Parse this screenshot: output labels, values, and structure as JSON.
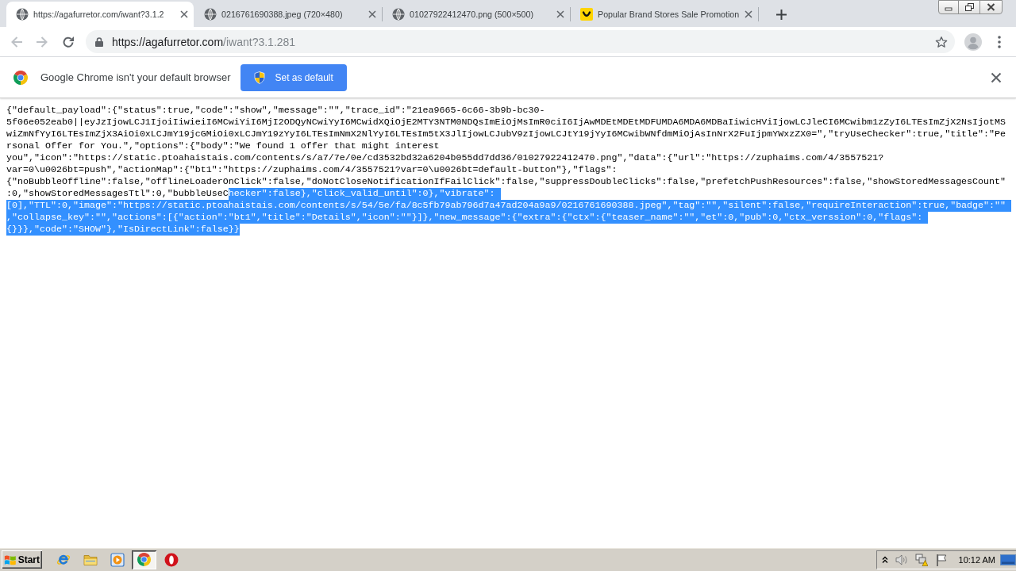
{
  "tabs": [
    {
      "title": "https://agafurretor.com/iwant?3.1.2",
      "kind": "globe",
      "selected": true
    },
    {
      "title": "0216761690388.jpeg (720×480)",
      "kind": "globe",
      "selected": false
    },
    {
      "title": "01027922412470.png (500×500)",
      "kind": "globe",
      "selected": false
    },
    {
      "title": "Popular Brand Stores Sale Promotion",
      "kind": "smiley",
      "selected": false
    }
  ],
  "toolbar": {
    "nav_buttons": [
      {
        "kind": "back",
        "disabled": true
      },
      {
        "kind": "forward",
        "disabled": true
      },
      {
        "kind": "reload",
        "disabled": false
      }
    ],
    "address": {
      "host": "https://agafurretor.com",
      "path": "/iwant?3.1.281"
    }
  },
  "infobar": {
    "message": "Google Chrome isn't your default browser",
    "button": "Set as default"
  },
  "page_text": {
    "lines": [
      {
        "segments": [
          {
            "text": "{\"default_payload\":{\"status\":true,\"code\":\"show\",\"message\":\"\",\"trace_id\":\"21ea9665-6c66-3b9b-bc30-",
            "selected": false
          }
        ]
      },
      {
        "segments": [
          {
            "text": "5f06e052eab0||eyJzIjowLCJ1IjoiIiwieiI6MCwiYiI6MjI2ODQyNCwiYyI6MCwidXQiOjE2MTY3NTM0NDQsImEiOjMsImR0ciI6IjAwMDEtMDEtMDFUMDA6MDA6MDBaIiwicHViIjowLCJleCI6MCwibm1zZyI6LTEsImZjX2NsIjotMS",
            "selected": false
          }
        ]
      },
      {
        "segments": [
          {
            "text": "wiZmNfYyI6LTEsImZjX3AiOi0xLCJmY19jcGMiOi0xLCJmY19zYyI6LTEsImNmX2NlYyI6LTEsIm5tX3JlIjowLCJubV9zIjowLCJtY19jYyI6MCwibWNfdmMiOjAsInNrX2FuIjpmYWxzZX0=\",\"tryUseChecker\":true,\"title\":\"Pe",
            "selected": false
          }
        ]
      },
      {
        "segments": [
          {
            "text": "rsonal Offer for You.\",\"options\":{\"body\":\"We found 1 offer that might interest",
            "selected": false
          }
        ]
      },
      {
        "segments": [
          {
            "text": "you\",\"icon\":\"https://static.ptoahaistais.com/contents/s/a7/7e/0e/cd3532bd32a6204b055dd7dd36/01027922412470.png\",\"data\":{\"url\":\"https://zuphaims.com/4/3557521?",
            "selected": false
          }
        ]
      },
      {
        "segments": [
          {
            "text": "var=0\\u0026bt=push\",\"actionMap\":{\"bt1\":\"https://zuphaims.com/4/3557521?var=0\\u0026bt=default-button\"},\"flags\":",
            "selected": false
          }
        ]
      },
      {
        "segments": [
          {
            "text": "{\"noBubbleOffline\":false,\"offlineLoaderOnClick\":false,\"doNotCloseNotificationIfFailClick\":false,\"suppressDoubleClicks\":false,\"prefetchPushResources\":false,\"showStoredMessagesCount\"",
            "selected": false
          }
        ]
      },
      {
        "segments": [
          {
            "text": ":0,\"showStoredMessagesTtl\":0,\"bubbleUseC",
            "selected": false
          },
          {
            "text": "hecker\":false},\"click_valid_until\":0},\"vibrate\":",
            "selected": true
          }
        ]
      },
      {
        "segments": [
          {
            "text": "[0],\"TTL\":0,\"image\":\"https://static.ptoahaistais.com/contents/s/54/5e/fa/8c5fb79ab796d7a47ad204a9a9/0216761690388.jpeg\",\"tag\":\"\",\"silent\":false,\"requireInteraction\":true,\"badge\":\"\"",
            "selected": true
          }
        ]
      },
      {
        "segments": [
          {
            "text": ",\"collapse_key\":\"\",\"actions\":[{\"action\":\"bt1\",\"title\":\"Details\",\"icon\":\"\"}]},\"new_message\":{\"extra\":{\"ctx\":{\"teaser_name\":\"\",\"et\":0,\"pub\":0,\"ctx_verssion\":0,\"flags\":",
            "selected": true
          }
        ]
      },
      {
        "segments": [
          {
            "text": "{}}},\"code\":\"SHOW\"},\"IsDirectLink\":false}}",
            "selected": true
          }
        ]
      }
    ]
  },
  "taskbar": {
    "start": "Start",
    "apps": [
      {
        "kind": "explorer",
        "selected": false
      },
      {
        "kind": "folder",
        "selected": false
      },
      {
        "kind": "player",
        "selected": false
      },
      {
        "kind": "chrome",
        "selected": true
      },
      {
        "kind": "opera",
        "selected": false
      }
    ],
    "tray": {
      "clock": "10:12 AM"
    }
  }
}
